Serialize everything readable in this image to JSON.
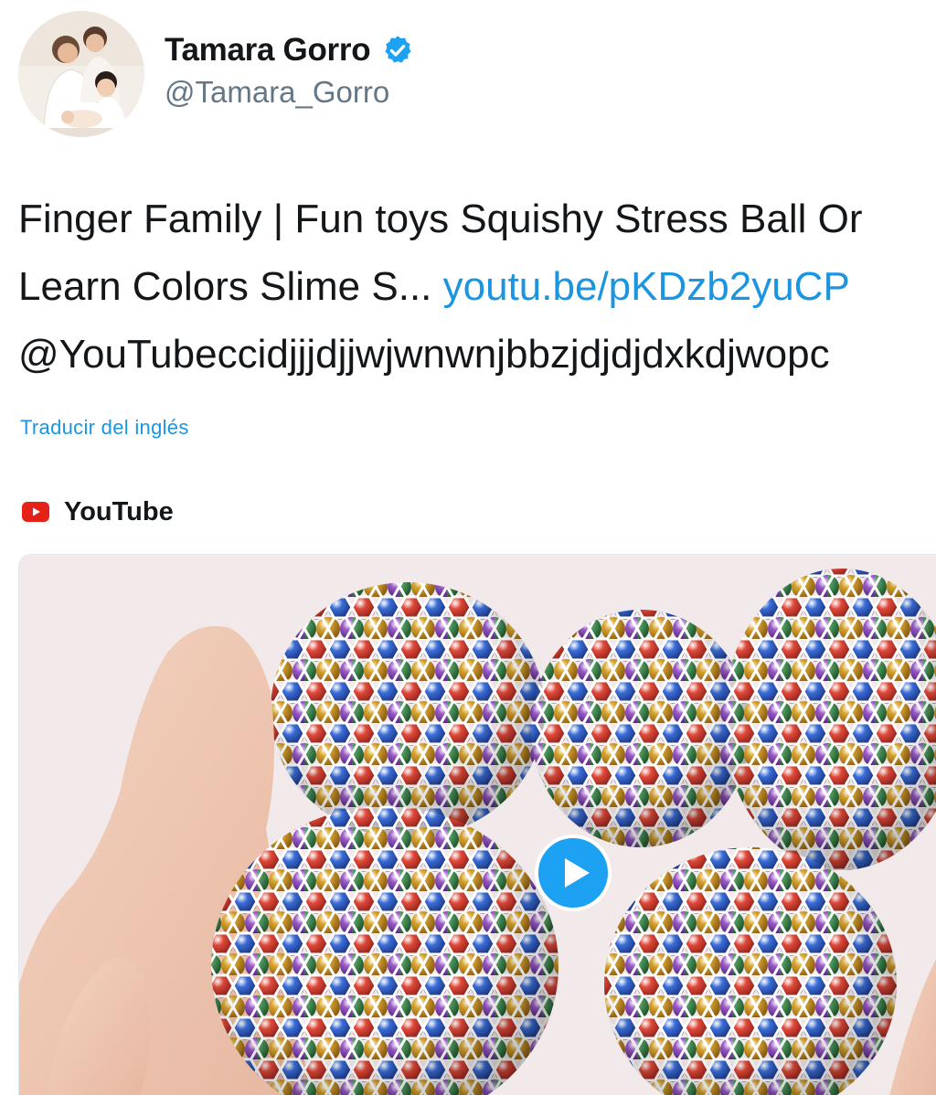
{
  "tweet": {
    "author": {
      "display_name": "Tamara Gorro",
      "handle": "@Tamara_Gorro",
      "verified": true,
      "avatar_icon": "avatar-photo",
      "verified_icon": "verified-badge-icon"
    },
    "text_lines": [
      "Finger Family | Fun toys Squishy Stress Ball Or",
      "Learn Colors Slime S...",
      "@YouTubeccidjjjdjjwjwnwnjbbzjdjdjdxkdjwopc"
    ],
    "link_text": "youtu.be/pKDzb2yuCP",
    "translate_label": "Traducir del inglés"
  },
  "card": {
    "source_name": "YouTube",
    "source_icon": "youtube-icon",
    "play_icon": "play-icon"
  },
  "colors": {
    "link": "#1b95e0",
    "text": "#14171a",
    "secondary": "#657786",
    "youtube_red": "#e62117"
  }
}
